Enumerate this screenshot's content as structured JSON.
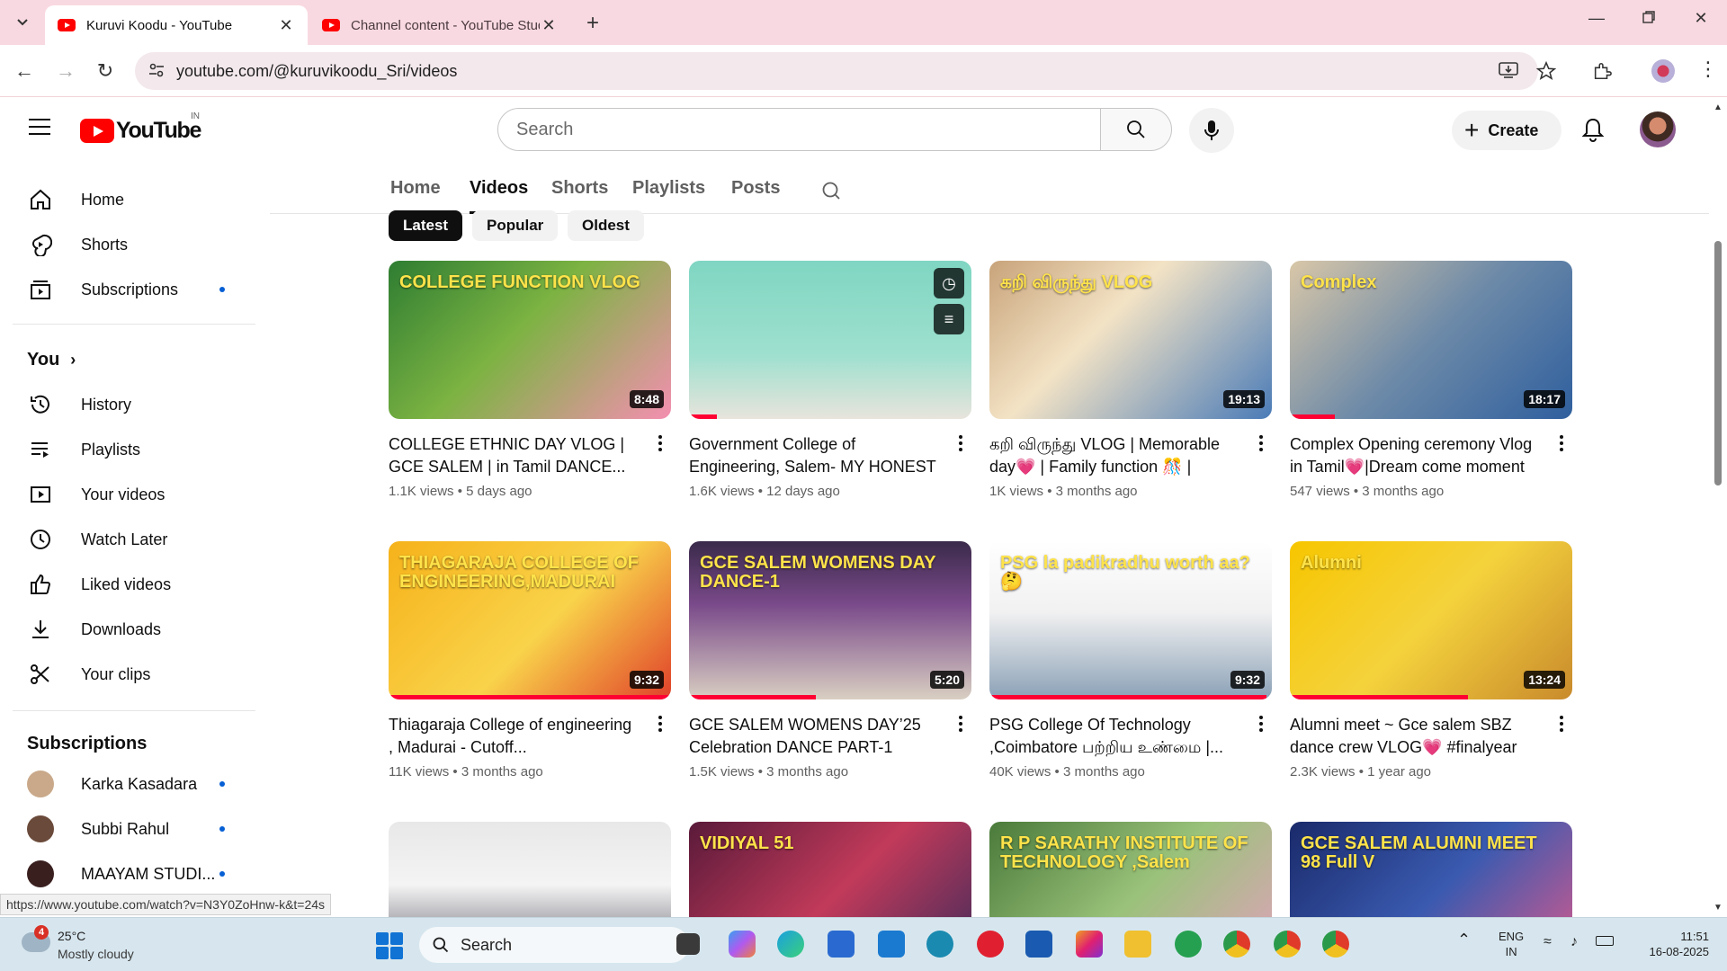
{
  "browser": {
    "tabs": [
      {
        "title": "Kuruvi Koodu - YouTube",
        "active": true
      },
      {
        "title": "Channel content - YouTube Studio",
        "active": false
      }
    ],
    "url": "youtube.com/@kuruvikoodu_Sri/videos"
  },
  "youtube": {
    "logo_text": "YouTube",
    "country_code": "IN",
    "search_placeholder": "Search",
    "create_label": "Create"
  },
  "sidebar": {
    "main": [
      {
        "label": "Home",
        "icon": "home-icon"
      },
      {
        "label": "Shorts",
        "icon": "shorts-icon"
      },
      {
        "label": "Subscriptions",
        "icon": "subscriptions-icon",
        "dot": true
      }
    ],
    "you_heading": "You",
    "you_items": [
      {
        "label": "History",
        "icon": "history-icon"
      },
      {
        "label": "Playlists",
        "icon": "playlists-icon"
      },
      {
        "label": "Your videos",
        "icon": "your-videos-icon"
      },
      {
        "label": "Watch Later",
        "icon": "watch-later-icon"
      },
      {
        "label": "Liked videos",
        "icon": "liked-icon"
      },
      {
        "label": "Downloads",
        "icon": "download-icon"
      },
      {
        "label": "Your clips",
        "icon": "scissors-icon"
      }
    ],
    "subs_heading": "Subscriptions",
    "subscriptions": [
      {
        "label": "Karka Kasadara",
        "color": "#c9a98a"
      },
      {
        "label": "Subbi Rahul",
        "color": "#6a4a3a"
      },
      {
        "label": "MAAYAM STUDI...",
        "color": "#3a1f1f"
      }
    ]
  },
  "channel_tabs": [
    "Home",
    "Videos",
    "Shorts",
    "Playlists",
    "Posts"
  ],
  "active_tab": "Videos",
  "chips": [
    "Latest",
    "Popular",
    "Oldest"
  ],
  "videos": [
    {
      "title": "COLLEGE ETHNIC DAY VLOG | GCE SALEM | in Tamil DANCE...",
      "views": "1.1K views",
      "age": "5 days ago",
      "duration": "8:48",
      "overlay": "COLLEGE FUNCTION VLOG",
      "bg": "linear-gradient(135deg,#2e7d32 0%,#7cb342 45%,#f48fb1 100%)",
      "progress": 0
    },
    {
      "title": "Government College of Engineering, Salem- MY HONEST REVIEW AS A...",
      "views": "1.6K views",
      "age": "12 days ago",
      "duration": "",
      "overlay": "",
      "bg": "linear-gradient(180deg,#7fd6c2 0%,#9fe0cf 60%,#e8e4dc 100%)",
      "progress": 0.1
    },
    {
      "title": "கறி விருந்து VLOG | Memorable day💗 | Family function 🎊 | Thath...",
      "views": "1K views",
      "age": "3 months ago",
      "duration": "19:13",
      "overlay": "கறி விருந்து VLOG",
      "bg": "linear-gradient(135deg,#c8a37a 0%,#f3e3c5 40%,#4a7bb7 100%)",
      "progress": 0
    },
    {
      "title": "Complex Opening ceremony Vlog in Tamil💗|Dream come moment🪄",
      "views": "547 views",
      "age": "3 months ago",
      "duration": "18:17",
      "overlay": "Complex",
      "bg": "linear-gradient(135deg,#d9c7a8 0%,#6d8aa8 50%,#2f5f9e 100%)",
      "progress": 0.16
    },
    {
      "title": "Thiagaraja College of engineering , Madurai - Cutoff...",
      "views": "11K views",
      "age": "3 months ago",
      "duration": "9:32",
      "overlay": "THIAGARAJA COLLEGE OF ENGINEERING,MADURAI",
      "bg": "linear-gradient(135deg,#f6b21a 0%,#f9d34a 55%,#e0402a 100%)",
      "progress": 1.0
    },
    {
      "title": "GCE SALEM WOMENS DAY’25 Celebration DANCE PART-1",
      "views": "1.5K views",
      "age": "3 months ago",
      "duration": "5:20",
      "overlay": "GCE SALEM WOMENS DAY DANCE-1",
      "bg": "linear-gradient(180deg,#3a2a4a 0%,#7a4a8a 40%,#d9cfc2 100%)",
      "progress": 0.45
    },
    {
      "title": "PSG College Of Technology ,Coimbatore பற்றிய உண்மை |...",
      "views": "40K views",
      "age": "3 months ago",
      "duration": "9:32",
      "overlay": "PSG la padikradhu worth aa? 🤔",
      "bg": "linear-gradient(180deg,#ffffff 0%,#f1f1f1 45%,#8aa0b6 100%)",
      "progress": 0.98
    },
    {
      "title": "Alumni meet ~ Gce salem SBZ dance crew VLOG💗 #finalyear",
      "views": "2.3K views",
      "age": "1 year ago",
      "duration": "13:24",
      "overlay": "Alumni",
      "bg": "linear-gradient(135deg,#f7c600 0%,#f4d23c 50%,#c98a2c 100%)",
      "progress": 0.63
    },
    {
      "title": "",
      "views": "",
      "age": "",
      "duration": "",
      "overlay": "",
      "bg": "linear-gradient(180deg,#e8e8e8 0%,#f4f4f4 40%,#3a3a4a 100%)",
      "progress": 0
    },
    {
      "title": "",
      "views": "",
      "age": "",
      "duration": "",
      "overlay": "VIDIYAL 51",
      "bg": "linear-gradient(135deg,#5a1a3a 0%,#c23a5a 50%,#3a2a5a 100%)",
      "progress": 0
    },
    {
      "title": "",
      "views": "",
      "age": "",
      "duration": "",
      "overlay": "R P SARATHY INSTITUTE OF TECHNOLOGY ,Salem",
      "bg": "linear-gradient(135deg,#4a7a3a 0%,#9ac27a 50%,#e5a0c0 100%)",
      "progress": 0
    },
    {
      "title": "",
      "views": "",
      "age": "",
      "duration": "",
      "overlay": "GCE SALEM ALUMNI MEET 98 Full V",
      "bg": "linear-gradient(135deg,#1a2a6a 0%,#3a5ab0 50%,#e05a8a 100%)",
      "progress": 0
    }
  ],
  "status_url": "https://www.youtube.com/watch?v=N3Y0ZoHnw-k&t=24s",
  "taskbar": {
    "weather_temp": "25°C",
    "weather_desc": "Mostly cloudy",
    "weather_badge": "4",
    "search_label": "Search",
    "lang_top": "ENG",
    "lang_bottom": "IN",
    "time": "11:51",
    "date": "16-08-2025"
  }
}
